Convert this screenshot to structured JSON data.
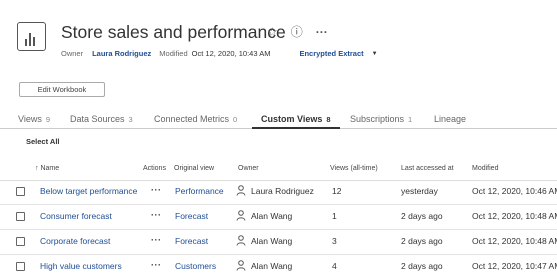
{
  "header": {
    "title": "Store sales and performance",
    "favorite_icon": "☆",
    "info_icon": "ⓘ",
    "more_icon": "···"
  },
  "meta": {
    "owner_label": "Owner",
    "owner_name": "Laura Rodriguez",
    "modified_label": "Modified",
    "modified_value": "Oct 12, 2020, 10:43 AM",
    "extract_label": "Encrypted Extract",
    "extract_caret": "▼"
  },
  "edit_button": "Edit Workbook",
  "tabs": [
    {
      "label": "Views",
      "count": "9"
    },
    {
      "label": "Data Sources",
      "count": "3"
    },
    {
      "label": "Connected Metrics",
      "count": "0"
    },
    {
      "label": "Custom Views",
      "count": "8"
    },
    {
      "label": "Subscriptions",
      "count": "1"
    },
    {
      "label": "Lineage",
      "count": ""
    }
  ],
  "select_all": "Select All",
  "columns": {
    "name": "↑ Name",
    "actions": "Actions",
    "original_view": "Original view",
    "owner": "Owner",
    "views": "Views (all-time)",
    "last_accessed": "Last accessed at",
    "modified": "Modified"
  },
  "rows": [
    {
      "name": "Below target performance",
      "actions": "···",
      "view": "Performance",
      "owner": "Laura Rodriguez",
      "views": "12",
      "last": "yesterday",
      "modified": "Oct 12, 2020, 10:46 AM"
    },
    {
      "name": "Consumer forecast",
      "actions": "···",
      "view": "Forecast",
      "owner": "Alan Wang",
      "views": "1",
      "last": "2 days ago",
      "modified": "Oct 12, 2020, 10:48 AM"
    },
    {
      "name": "Corporate forecast",
      "actions": "···",
      "view": "Forecast",
      "owner": "Alan Wang",
      "views": "3",
      "last": "2 days ago",
      "modified": "Oct 12, 2020, 10:48 AM"
    },
    {
      "name": "High value customers",
      "actions": "···",
      "view": "Customers",
      "owner": "Alan Wang",
      "views": "4",
      "last": "2 days ago",
      "modified": "Oct 12, 2020, 10:47 AM"
    }
  ]
}
